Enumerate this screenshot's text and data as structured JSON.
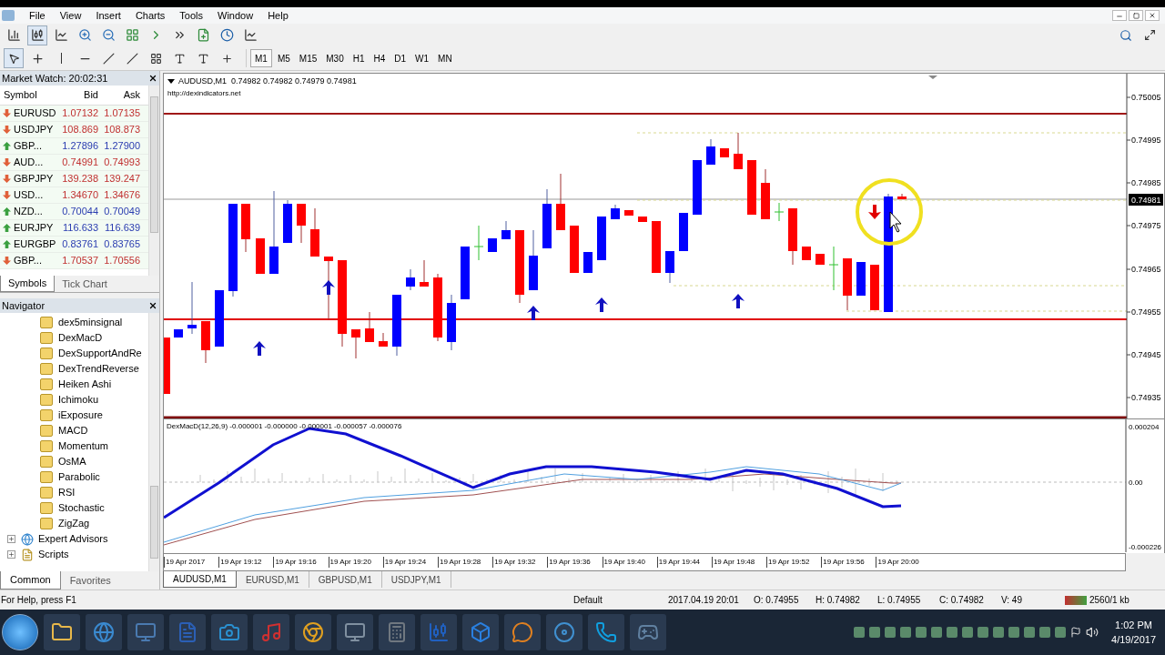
{
  "menu": [
    "File",
    "View",
    "Insert",
    "Charts",
    "Tools",
    "Window",
    "Help"
  ],
  "timeframes": [
    {
      "label": "M1",
      "selected": true
    },
    {
      "label": "M5",
      "selected": false
    },
    {
      "label": "M15",
      "selected": false
    },
    {
      "label": "M30",
      "selected": false
    },
    {
      "label": "H1",
      "selected": false
    },
    {
      "label": "H4",
      "selected": false
    },
    {
      "label": "D1",
      "selected": false
    },
    {
      "label": "W1",
      "selected": false
    },
    {
      "label": "MN",
      "selected": false
    }
  ],
  "market_watch": {
    "title": "Market Watch: 20:02:31",
    "columns": [
      "Symbol",
      "Bid",
      "Ask"
    ],
    "rows": [
      {
        "symbol": "EURUSD",
        "bid": "1.07132",
        "ask": "1.07135",
        "rising": false
      },
      {
        "symbol": "USDJPY",
        "bid": "108.869",
        "ask": "108.873",
        "rising": false
      },
      {
        "symbol": "GBP...",
        "bid": "1.27896",
        "ask": "1.27900",
        "rising": true
      },
      {
        "symbol": "AUD...",
        "bid": "0.74991",
        "ask": "0.74993",
        "rising": false
      },
      {
        "symbol": "GBPJPY",
        "bid": "139.238",
        "ask": "139.247",
        "rising": false
      },
      {
        "symbol": "USD...",
        "bid": "1.34670",
        "ask": "1.34676",
        "rising": false
      },
      {
        "symbol": "NZD...",
        "bid": "0.70044",
        "ask": "0.70049",
        "rising": true
      },
      {
        "symbol": "EURJPY",
        "bid": "116.633",
        "ask": "116.639",
        "rising": true
      },
      {
        "symbol": "EURGBP",
        "bid": "0.83761",
        "ask": "0.83765",
        "rising": true
      },
      {
        "symbol": "GBP...",
        "bid": "1.70537",
        "ask": "1.70556",
        "rising": false
      }
    ],
    "tabs": [
      {
        "label": "Symbols",
        "selected": true
      },
      {
        "label": "Tick Chart",
        "selected": false
      }
    ]
  },
  "navigator": {
    "title": "Navigator",
    "indicators": [
      "dex5minsignal",
      "DexMacD",
      "DexSupportAndRe",
      "DexTrendReverse",
      "Heiken Ashi",
      "Ichimoku",
      "iExposure",
      "MACD",
      "Momentum",
      "OsMA",
      "Parabolic",
      "RSI",
      "Stochastic",
      "ZigZag"
    ],
    "folders": [
      {
        "label": "Expert Advisors",
        "kind": "experts",
        "expanded": false
      },
      {
        "label": "Scripts",
        "kind": "scripts",
        "expanded": false
      }
    ],
    "tabs": [
      {
        "label": "Common",
        "selected": true
      },
      {
        "label": "Favorites",
        "selected": false
      }
    ]
  },
  "chart": {
    "header": "AUDUSD,M1  0.74982 0.74982 0.74979 0.74981",
    "url": "http://dexindicators.net",
    "price_ticks": [
      "0.75005",
      "0.74995",
      "0.74985",
      "0.74975",
      "0.74965",
      "0.74955",
      "0.74945",
      "0.74935"
    ],
    "current_price": "0.74981",
    "macd_label": "DexMacD(12,26,9) -0.000001 -0.000000 -0.000001 -0.000057 -0.000076",
    "macd_ticks": [
      "0.000204",
      "0.00",
      "-0.000226"
    ],
    "time_ticks": [
      "19 Apr 2017",
      "19 Apr 19:12",
      "19 Apr 19:16",
      "19 Apr 19:20",
      "19 Apr 19:24",
      "19 Apr 19:28",
      "19 Apr 19:32",
      "19 Apr 19:36",
      "19 Apr 19:40",
      "19 Apr 19:44",
      "19 Apr 19:48",
      "19 Apr 19:52",
      "19 Apr 19:56",
      "19 Apr 20:00"
    ]
  },
  "chart_tabs": [
    {
      "label": "AUDUSD,M1",
      "selected": true
    },
    {
      "label": "EURUSD,M1",
      "selected": false
    },
    {
      "label": "GBPUSD,M1",
      "selected": false
    },
    {
      "label": "USDJPY,M1",
      "selected": false
    }
  ],
  "status_bar": {
    "help": "For Help, press F1",
    "profile": "Default",
    "time": "2017.04.19 20:01",
    "open": "O: 0.74955",
    "high": "H: 0.74982",
    "low": "L: 0.74955",
    "close": "C: 0.74982",
    "volume": "V: 49",
    "traffic": "2560/1 kb"
  },
  "taskbar": {
    "time": "1:02 PM",
    "date": "4/19/2017"
  }
}
